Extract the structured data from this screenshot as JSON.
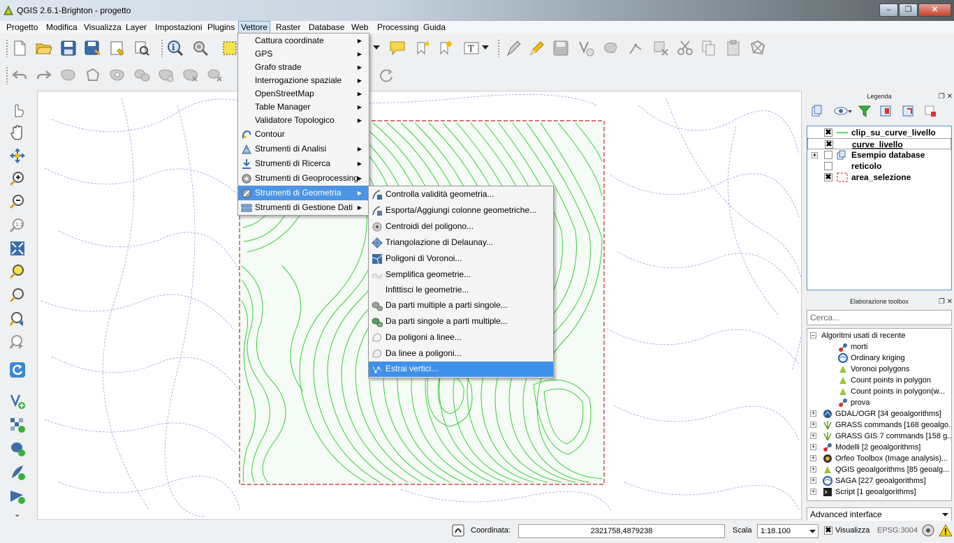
{
  "window": {
    "title": "QGIS 2.6.1-Brighton - progetto",
    "controls": [
      "‒",
      "❐",
      "✕"
    ]
  },
  "menubar": [
    "Progetto",
    "Modifica",
    "Visualizza",
    "Layer",
    "Impostazioni",
    "Plugins",
    "Vettore",
    "Raster",
    "Database",
    "Web",
    "Processing",
    "Guida"
  ],
  "vettore_menu": [
    {
      "label": "Cattura coordinate",
      "submenu": true
    },
    {
      "label": "GPS",
      "submenu": true
    },
    {
      "label": "Grafo strade",
      "submenu": true
    },
    {
      "label": "Interrogazione spaziale",
      "submenu": true
    },
    {
      "label": "OpenStreetMap",
      "submenu": true
    },
    {
      "label": "Table Manager",
      "submenu": true
    },
    {
      "label": "Validatore Topologico",
      "submenu": true
    },
    {
      "label": "Contour",
      "submenu": false
    },
    {
      "label": "Strumenti di Analisi",
      "submenu": true
    },
    {
      "label": "Strumenti di Ricerca",
      "submenu": true
    },
    {
      "label": "Strumenti di Geoprocessing",
      "submenu": true
    },
    {
      "label": "Strumenti di Geometria",
      "submenu": true,
      "highlighted": true
    },
    {
      "label": "Strumenti di Gestione Dati",
      "submenu": true
    }
  ],
  "geometria_menu": [
    {
      "label": "Controlla validità geometria...",
      "icon": "validate-geometry-icon"
    },
    {
      "label": "Esporta/Aggiungi colonne geometriche...",
      "icon": "export-geometry-columns-icon"
    },
    {
      "label": "Centroidi del poligono...",
      "icon": "centroids-icon"
    },
    {
      "label": "Triangolazione di Delaunay...",
      "icon": "delaunay-icon"
    },
    {
      "label": "Poligoni di Voronoi...",
      "icon": "voronoi-icon"
    },
    {
      "label": "Semplifica geometrie...",
      "icon": "simplify-icon"
    },
    {
      "label": "Infittisci le geometrie...",
      "icon": ""
    },
    {
      "label": "Da parti multiple a parti singole...",
      "icon": "multi-to-single-icon"
    },
    {
      "label": "Da parti singole a parti multiple...",
      "icon": "single-to-multi-icon"
    },
    {
      "label": "Da poligoni a linee...",
      "icon": "polygon-to-lines-icon"
    },
    {
      "label": "Da linee a poligoni...",
      "icon": "lines-to-polygon-icon"
    },
    {
      "label": "Estrai vertici...",
      "icon": "extract-vertices-icon",
      "highlighted": true
    }
  ],
  "legend": {
    "title": "Legenda",
    "layers": [
      {
        "name": "clip_su_curve_livello",
        "checked": true,
        "symbol": "green-line",
        "expandable": false,
        "underline": false
      },
      {
        "name": "curve_livello",
        "checked": true,
        "symbol": "none",
        "expandable": false,
        "underline": true
      },
      {
        "name": "Esempio database",
        "checked": false,
        "symbol": "group",
        "expandable": true,
        "underline": false
      },
      {
        "name": "reticolo",
        "checked": false,
        "symbol": "none",
        "expandable": false,
        "underline": false
      },
      {
        "name": "area_selezione",
        "checked": true,
        "symbol": "red-dashed-polygon",
        "expandable": false,
        "underline": false
      }
    ]
  },
  "toolbox": {
    "title": "Elaborazione toolbox",
    "search_placeholder": "Cerca...",
    "recent_group": "Algoritmi usati di recente",
    "recent": [
      "morti",
      "Ordinary kriging",
      "Voronoi polygons",
      "Count points in polygon",
      "Count points in polygon(w...",
      "prova"
    ],
    "providers": [
      "GDAL/OGR [34 geoalgorithms]",
      "GRASS commands [168 geoalgo...",
      "GRASS GIS 7 commands [158 g...",
      "Modelli [2 geoalgorithms]",
      "Orfeo Toolbox (Image analysis)...",
      "QGIS geoalgorithms [85 geoalg...",
      "SAGA [227 geoalgorithms]",
      "Script [1 geoalgorithms]"
    ],
    "advanced": "Advanced interface"
  },
  "statusbar": {
    "coord_label": "Coordinata:",
    "coord_value": "2321758,4879238",
    "scale_label": "Scala",
    "scale_value": "1:18.100",
    "render_label": "Visualizza",
    "epsg": "EPSG:3004"
  },
  "colors": {
    "menu_highlight": "#3d8ee8",
    "contour_green": "#22cc22",
    "selection_red": "#cc2222",
    "legend_border": "#5a91d6"
  }
}
